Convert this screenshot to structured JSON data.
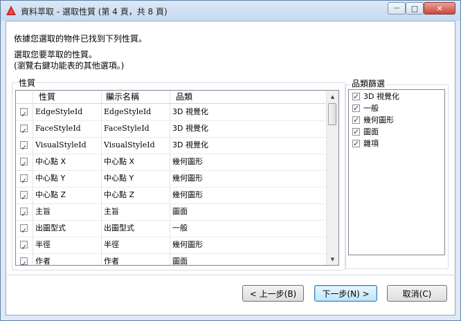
{
  "window": {
    "title": "資料萃取 - 選取性質 (第 4 頁，共 8 頁)",
    "min_glyph": "—",
    "max_glyph": "□",
    "close_glyph": "✕"
  },
  "instructions": {
    "line1": "依據您選取的物件已找到下列性質。",
    "line2": "選取您要萃取的性質。",
    "line3": "(瀏覽右鍵功能表的其他選項。)"
  },
  "properties": {
    "group_label": "性質",
    "columns": [
      "性質",
      "顯示名稱",
      "品類"
    ],
    "rows": [
      {
        "property": "EdgeStyleId",
        "display": "EdgeStyleId",
        "category": "3D 視覺化",
        "checked": true
      },
      {
        "property": "FaceStyleId",
        "display": "FaceStyleId",
        "category": "3D 視覺化",
        "checked": true
      },
      {
        "property": "VisualStyleId",
        "display": "VisualStyleId",
        "category": "3D 視覺化",
        "checked": true
      },
      {
        "property": "中心點 X",
        "display": "中心點 X",
        "category": "幾何圖形",
        "checked": true
      },
      {
        "property": "中心點 Y",
        "display": "中心點 Y",
        "category": "幾何圖形",
        "checked": true
      },
      {
        "property": "中心點 Z",
        "display": "中心點 Z",
        "category": "幾何圖形",
        "checked": true
      },
      {
        "property": "主旨",
        "display": "主旨",
        "category": "圖面",
        "checked": true
      },
      {
        "property": "出圖型式",
        "display": "出圖型式",
        "category": "一般",
        "checked": true
      },
      {
        "property": "半徑",
        "display": "半徑",
        "category": "幾何圖形",
        "checked": true
      },
      {
        "property": "作者",
        "display": "作者",
        "category": "圖面",
        "checked": true
      }
    ]
  },
  "category_filter": {
    "group_label": "品類篩選",
    "items": [
      {
        "label": "3D 視覺化",
        "checked": true
      },
      {
        "label": "一般",
        "checked": true
      },
      {
        "label": "幾何圖形",
        "checked": true
      },
      {
        "label": "圖面",
        "checked": true
      },
      {
        "label": "雜項",
        "checked": true
      }
    ]
  },
  "buttons": {
    "back": "< 上一步(B)",
    "next": "下一步(N) >",
    "cancel": "取消(C)"
  }
}
